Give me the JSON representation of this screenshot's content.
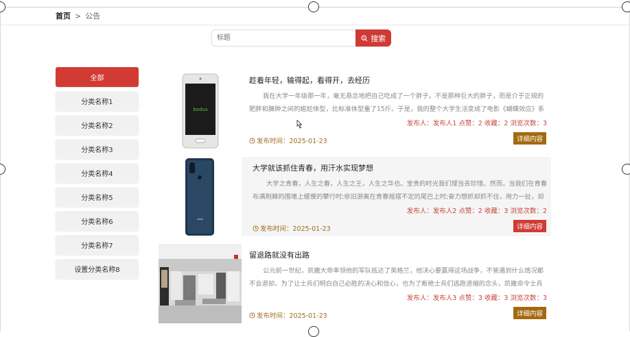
{
  "breadcrumb": {
    "home": "首页",
    "separator": ">",
    "current": "公告"
  },
  "search": {
    "placeholder": "标题",
    "button_label": "搜索",
    "icon": "search-icon"
  },
  "sidebar": {
    "items": [
      {
        "label": "全部",
        "active": true
      },
      {
        "label": "分类名称1"
      },
      {
        "label": "分类名称2"
      },
      {
        "label": "分类名称3"
      },
      {
        "label": "分类名称4"
      },
      {
        "label": "分类名称5"
      },
      {
        "label": "分类名称6"
      },
      {
        "label": "分类名称7"
      },
      {
        "label": "设置分类名称8"
      }
    ]
  },
  "articles": [
    {
      "title": "趁着年轻，输得起，看得开，去经历",
      "excerpt": "我在大学一年级那一年，毫无悬念地把自己吃成了一个胖子。不是那种巨大的胖子，而是介于正规的肥胖和臃肿之间的尴尬体型，比标准体型重了15斤。于是，我的整个大学生活变成了电影《蝴蝶效应》系列，那",
      "meta": "发布人：发布人1  点赞：2  收藏：2  浏览次数：3",
      "date": "发布时间：2025-01-23",
      "detail_label": "详细内容",
      "detail_color": "#a4690f",
      "image": "phone-white"
    },
    {
      "title": "大学就该抓住青春，用汗水实现梦想",
      "excerpt": "大学之青春，人生之春，人生之王，人生之华也。宝贵的时光我们理当去珍惜。然而，当我们在青春布满荆棘的围墙上缓慢的攀行时;依旧游离在青春摇摆不定的尾巴上时;奋力想抓却抓不住，用力一扯，却又是散",
      "meta": "发布人：发布人2  点赞：2  收藏：3  浏览次数：2",
      "date": "发布时间：2025-01-23",
      "detail_label": "详细内容",
      "detail_color": "#d13b33",
      "image": "phone-blue"
    },
    {
      "title": "留退路就没有出路",
      "excerpt": "公元前一世纪，凯撒大帝率领他的军队抵达了英格兰，他决心要赢得这场战争，不管遇到什么情况都不会退却。为了让士兵们明白自己必胜的决心和信心，也为了断绝士兵们逃跑退缩的念头，凯撒命令士兵将运载他",
      "meta": "发布人：发布人3  点赞：3  收藏：3  浏览次数：3",
      "date": "发布时间：2025-01-23",
      "detail_label": "详细内容",
      "detail_color": "#a4690f",
      "image": "store-interior"
    }
  ],
  "phone_screen_brand": "bodus"
}
